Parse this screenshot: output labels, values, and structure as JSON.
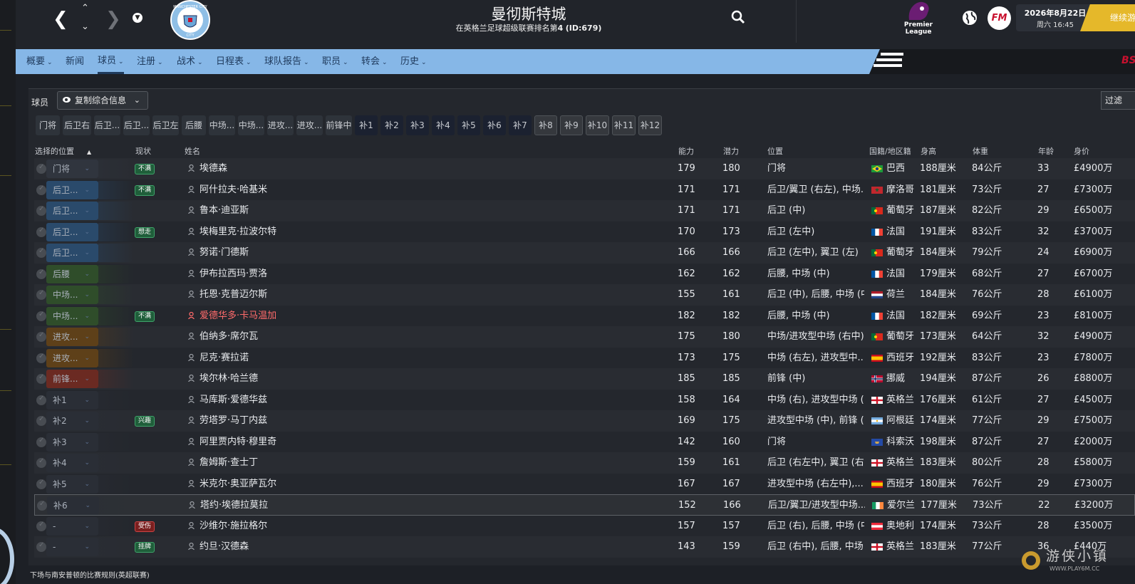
{
  "header": {
    "club_name": "曼彻斯特城",
    "standing_prefix": "在英格兰足球超级联赛排名第",
    "standing_rank": "4",
    "club_id": "(ID:679)",
    "league_logo_text": "Premier League",
    "fm_logo_text": "FM",
    "date": "2026年8月22日",
    "day_time": "周六 16:45",
    "continue_label": "继续游",
    "club_badge_text": "MANCHESTER CITY",
    "club_badge_short": "CITY"
  },
  "menu": {
    "items": [
      {
        "label": "概要",
        "dropdown": true
      },
      {
        "label": "新闻",
        "dropdown": false
      },
      {
        "label": "球员",
        "dropdown": true,
        "active": true
      },
      {
        "label": "注册",
        "dropdown": true
      },
      {
        "label": "战术",
        "dropdown": true
      },
      {
        "label": "日程表",
        "dropdown": true
      },
      {
        "label": "球队报告",
        "dropdown": true
      },
      {
        "label": "职员",
        "dropdown": true
      },
      {
        "label": "转会",
        "dropdown": true
      },
      {
        "label": "历史",
        "dropdown": true
      }
    ],
    "sponsor_text": "BS"
  },
  "panel": {
    "label": "球员",
    "view_button": "复制综合信息",
    "filter_button": "过滤"
  },
  "position_tabs": [
    {
      "label": "门将",
      "kind": "f"
    },
    {
      "label": "后卫右",
      "kind": "f"
    },
    {
      "label": "后卫...",
      "kind": "f"
    },
    {
      "label": "后卫...",
      "kind": "f"
    },
    {
      "label": "后卫左",
      "kind": "f"
    },
    {
      "label": "后腰",
      "kind": "f"
    },
    {
      "label": "中场...",
      "kind": "f"
    },
    {
      "label": "中场...",
      "kind": "f"
    },
    {
      "label": "进攻...",
      "kind": "f"
    },
    {
      "label": "进攻...",
      "kind": "f"
    },
    {
      "label": "前锋中",
      "kind": "f"
    },
    {
      "label": "补1",
      "kind": "s"
    },
    {
      "label": "补2",
      "kind": "s"
    },
    {
      "label": "补3",
      "kind": "s"
    },
    {
      "label": "补4",
      "kind": "s"
    },
    {
      "label": "补5",
      "kind": "s"
    },
    {
      "label": "补6",
      "kind": "s"
    },
    {
      "label": "补7",
      "kind": "s"
    },
    {
      "label": "补8",
      "kind": "r"
    },
    {
      "label": "补9",
      "kind": "r"
    },
    {
      "label": "补10",
      "kind": "r"
    },
    {
      "label": "补11",
      "kind": "r"
    },
    {
      "label": "补12",
      "kind": "r"
    }
  ],
  "columns": {
    "selected_position": "选择的位置",
    "status": "现状",
    "name": "姓名",
    "ability": "能力",
    "potential": "潜力",
    "position": "位置",
    "nationality": "国籍/地区籍",
    "height": "身高",
    "weight": "体重",
    "age": "年龄",
    "value": "身价"
  },
  "players": [
    {
      "pos": "门将",
      "group": "gk",
      "status": "不满",
      "status_type": "unhappy",
      "name": "埃德森",
      "ability": "179",
      "potential": "180",
      "position": "门将",
      "flag": "br",
      "nation": "巴西",
      "height": "188厘米",
      "weight": "84公斤",
      "age": "33",
      "value": "£4900万"
    },
    {
      "pos": "后卫...",
      "group": "def",
      "status": "不满",
      "status_type": "unhappy",
      "name": "阿什拉夫·哈基米",
      "ability": "171",
      "potential": "171",
      "position": "后卫/翼卫 (右左), 中场...",
      "flag": "ma",
      "nation": "摩洛哥",
      "height": "181厘米",
      "weight": "73公斤",
      "age": "27",
      "value": "£7300万"
    },
    {
      "pos": "后卫...",
      "group": "def",
      "status": "",
      "status_type": "",
      "name": "鲁本·迪亚斯",
      "ability": "171",
      "potential": "171",
      "position": "后卫 (中)",
      "flag": "pt",
      "nation": "葡萄牙",
      "height": "187厘米",
      "weight": "82公斤",
      "age": "29",
      "value": "£6500万"
    },
    {
      "pos": "后卫...",
      "group": "def",
      "status": "想走",
      "status_type": "unhappy",
      "name": "埃梅里克·拉波尔特",
      "ability": "170",
      "potential": "173",
      "position": "后卫 (左中)",
      "flag": "fr",
      "nation": "法国",
      "height": "191厘米",
      "weight": "83公斤",
      "age": "32",
      "value": "£3700万"
    },
    {
      "pos": "后卫...",
      "group": "def",
      "status": "",
      "status_type": "",
      "name": "努诺·门德斯",
      "ability": "166",
      "potential": "166",
      "position": "后卫 (左中), 翼卫 (左)",
      "flag": "pt",
      "nation": "葡萄牙",
      "height": "184厘米",
      "weight": "79公斤",
      "age": "24",
      "value": "£6900万"
    },
    {
      "pos": "后腰",
      "group": "mid",
      "status": "",
      "status_type": "",
      "name": "伊布拉西玛·贾洛",
      "ability": "162",
      "potential": "162",
      "position": "后腰, 中场 (中)",
      "flag": "fr",
      "nation": "法国",
      "height": "179厘米",
      "weight": "68公斤",
      "age": "27",
      "value": "£6700万"
    },
    {
      "pos": "中场...",
      "group": "mid",
      "status": "",
      "status_type": "",
      "name": "托恩·克普迈尔斯",
      "ability": "155",
      "potential": "161",
      "position": "后卫 (中), 后腰, 中场 (中)",
      "flag": "nl",
      "nation": "荷兰",
      "height": "184厘米",
      "weight": "76公斤",
      "age": "28",
      "value": "£6100万"
    },
    {
      "pos": "中场...",
      "group": "mid",
      "status": "不满",
      "status_type": "unhappy",
      "name": "爱德华多·卡马温加",
      "ability": "182",
      "potential": "182",
      "position": "后腰, 中场 (中)",
      "flag": "fr",
      "nation": "法国",
      "height": "182厘米",
      "weight": "69公斤",
      "age": "23",
      "value": "£8100万",
      "highlight": true
    },
    {
      "pos": "进攻...",
      "group": "am",
      "status": "",
      "status_type": "",
      "name": "伯纳多·席尔瓦",
      "ability": "175",
      "potential": "180",
      "position": "中场/进攻型中场 (右中)",
      "flag": "pt",
      "nation": "葡萄牙",
      "height": "173厘米",
      "weight": "64公斤",
      "age": "32",
      "value": "£4900万"
    },
    {
      "pos": "进攻...",
      "group": "am",
      "status": "",
      "status_type": "",
      "name": "尼克·赛拉诺",
      "ability": "173",
      "potential": "175",
      "position": "中场 (右左), 进攻型中...",
      "flag": "es",
      "nation": "西班牙",
      "height": "192厘米",
      "weight": "83公斤",
      "age": "23",
      "value": "£7800万"
    },
    {
      "pos": "前锋...",
      "group": "st",
      "status": "",
      "status_type": "",
      "name": "埃尔林·哈兰德",
      "ability": "185",
      "potential": "185",
      "position": "前锋 (中)",
      "flag": "no",
      "nation": "挪威",
      "height": "194厘米",
      "weight": "87公斤",
      "age": "26",
      "value": "£8800万"
    },
    {
      "pos": "补1",
      "group": "sub",
      "status": "",
      "status_type": "",
      "name": "马库斯·爱德华兹",
      "ability": "158",
      "potential": "164",
      "position": "中场 (右), 进攻型中场 (...",
      "flag": "en",
      "nation": "英格兰",
      "height": "176厘米",
      "weight": "61公斤",
      "age": "27",
      "value": "£4500万"
    },
    {
      "pos": "补2",
      "group": "sub",
      "status": "兴趣",
      "status_type": "interest",
      "name": "劳塔罗·马丁内兹",
      "ability": "169",
      "potential": "175",
      "position": "进攻型中场 (中), 前锋 (...",
      "flag": "ar",
      "nation": "阿根廷",
      "height": "174厘米",
      "weight": "77公斤",
      "age": "29",
      "value": "£7500万"
    },
    {
      "pos": "补3",
      "group": "sub",
      "status": "",
      "status_type": "",
      "name": "阿里贾内特·穆里奇",
      "ability": "142",
      "potential": "160",
      "position": "门将",
      "flag": "xk",
      "nation": "科索沃",
      "height": "198厘米",
      "weight": "87公斤",
      "age": "27",
      "value": "£2000万"
    },
    {
      "pos": "补4",
      "group": "sub",
      "status": "",
      "status_type": "",
      "name": "詹姆斯·查士丁",
      "ability": "159",
      "potential": "161",
      "position": "后卫 (右左中), 翼卫 (右...",
      "flag": "en",
      "nation": "英格兰",
      "height": "183厘米",
      "weight": "80公斤",
      "age": "28",
      "value": "£5800万"
    },
    {
      "pos": "补5",
      "group": "sub",
      "status": "",
      "status_type": "",
      "name": "米克尔·奥亚萨瓦尔",
      "ability": "167",
      "potential": "167",
      "position": "进攻型中场 (右左中),...",
      "flag": "es",
      "nation": "西班牙",
      "height": "180厘米",
      "weight": "76公斤",
      "age": "29",
      "value": "£7300万"
    },
    {
      "pos": "补6",
      "group": "sub",
      "status": "",
      "status_type": "",
      "name": "塔约·埃德拉莫拉",
      "ability": "152",
      "potential": "166",
      "position": "后卫/翼卫/进攻型中场...",
      "flag": "ie",
      "nation": "爱尔兰",
      "height": "177厘米",
      "weight": "73公斤",
      "age": "22",
      "value": "£3200万",
      "selected": true
    },
    {
      "pos": "-",
      "group": "none",
      "status": "受伤",
      "status_type": "injured",
      "name": "沙维尔·施拉格尔",
      "ability": "157",
      "potential": "157",
      "position": "后卫 (右), 后腰, 中场 (中)",
      "flag": "at",
      "nation": "奥地利",
      "height": "174厘米",
      "weight": "73公斤",
      "age": "28",
      "value": "£3500万"
    },
    {
      "pos": "-",
      "group": "none",
      "status": "挂牌",
      "status_type": "listed",
      "name": "约旦·汉德森",
      "ability": "143",
      "potential": "159",
      "position": "后卫 (右中), 后腰, 中场...",
      "flag": "en",
      "nation": "英格兰",
      "height": "183厘米",
      "weight": "77公斤",
      "age": "36",
      "value": "£440万"
    }
  ],
  "footer_note": "下场与南安普顿的比赛规则(英超联赛)",
  "watermark": {
    "title": "游侠小镇",
    "url": "WWW.PLAY6M.CC"
  },
  "colors": {
    "menu_bar": "#86b7e7",
    "continue": "#e5b82a",
    "gk": "#30353e",
    "def": "#2a4a6b",
    "mid": "#2f4d2a",
    "am": "#5e4019",
    "st": "#6b2a22",
    "sub": "#2a2e36",
    "none": "#2a2e36",
    "unhappy": "#1f5e3a",
    "interest": "#1f5e3a",
    "injured": "#7a1f1f",
    "listed": "#1f5e3a"
  }
}
